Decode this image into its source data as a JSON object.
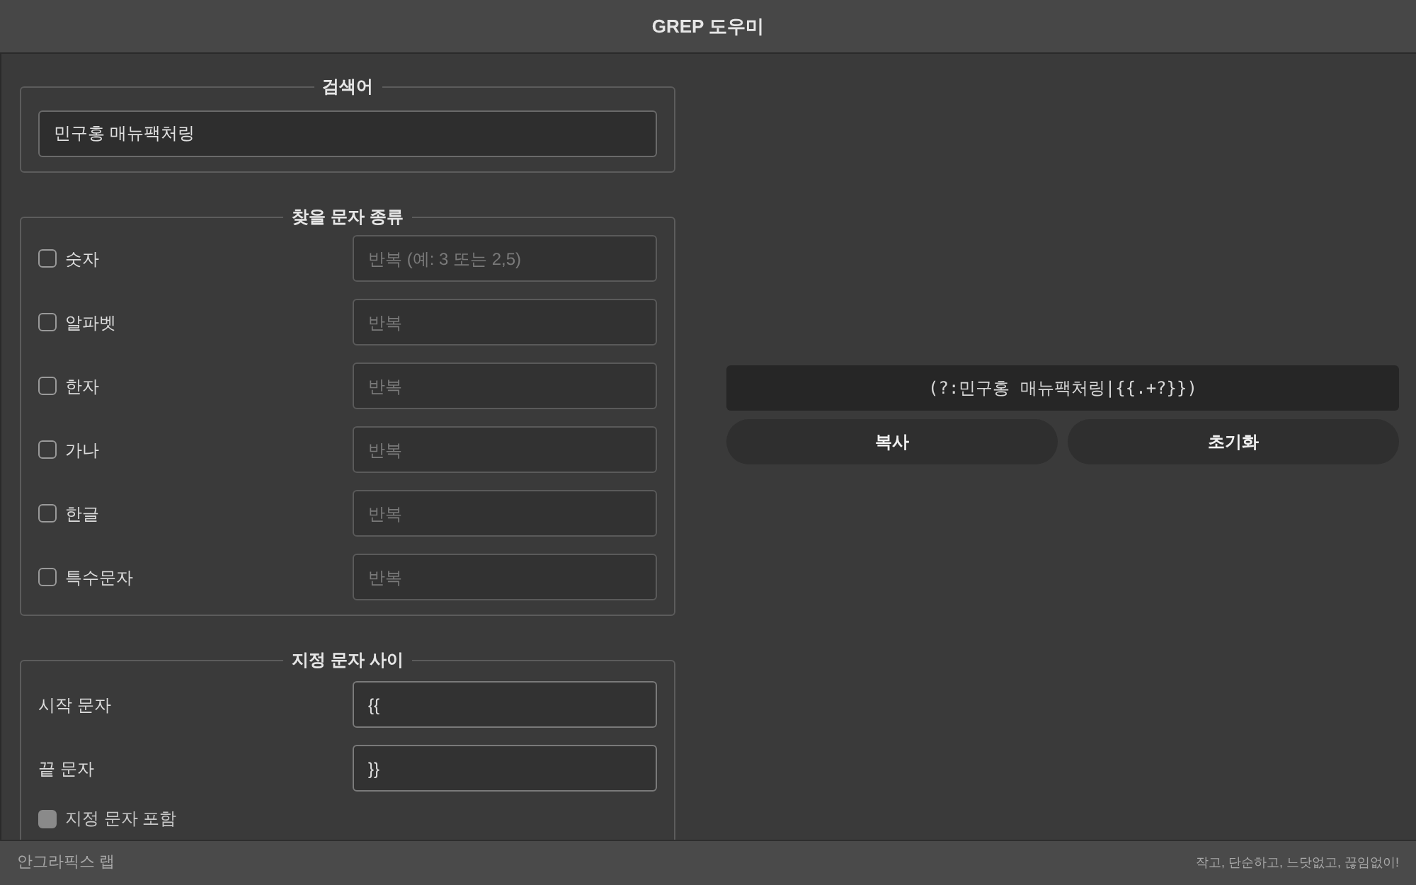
{
  "window": {
    "title": "GREP 도우미"
  },
  "search_group": {
    "title": "검색어",
    "value": "민구홍 매뉴팩처링"
  },
  "char_types": {
    "title": "찾을 문자 종류",
    "items": [
      {
        "label": "숫자",
        "checked": false,
        "placeholder": "반복 (예: 3 또는 2,5)"
      },
      {
        "label": "알파벳",
        "checked": false,
        "placeholder": "반복"
      },
      {
        "label": "한자",
        "checked": false,
        "placeholder": "반복"
      },
      {
        "label": "가나",
        "checked": false,
        "placeholder": "반복"
      },
      {
        "label": "한글",
        "checked": false,
        "placeholder": "반복"
      },
      {
        "label": "특수문자",
        "checked": false,
        "placeholder": "반복"
      }
    ]
  },
  "between": {
    "title": "지정 문자 사이",
    "fields": [
      {
        "label": "시작 문자",
        "value": "{{"
      },
      {
        "label": "끝 문자",
        "value": "}}"
      }
    ],
    "include": {
      "label": "지정 문자 포함",
      "checked": false,
      "disabled": true
    }
  },
  "result": {
    "text": "(?:민구홍 매뉴팩처링|{{.+?}})"
  },
  "buttons": [
    "복사",
    "초기화"
  ],
  "status_bar": {
    "left": "안그라픽스 랩",
    "right": "작고, 단순하고, 느닷없고, 끊임없이!"
  }
}
